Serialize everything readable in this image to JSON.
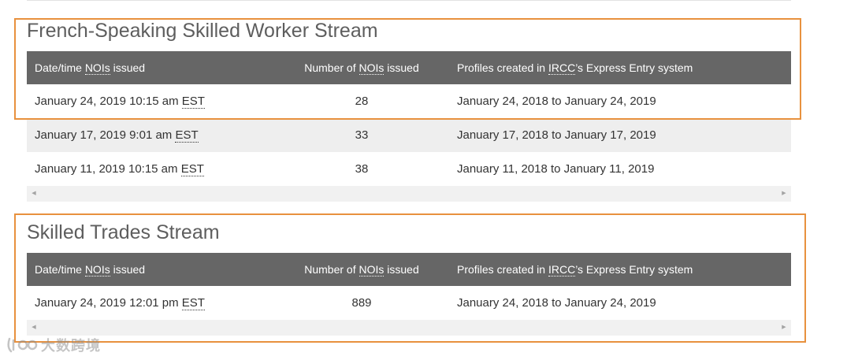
{
  "sections": [
    {
      "title": "French-Speaking Skilled Worker Stream",
      "headers": {
        "col1_pre": "Date/time ",
        "col1_abbr": "NOIs",
        "col1_post": " issued",
        "col2_pre": "Number of ",
        "col2_abbr": "NOIs",
        "col2_post": " issued",
        "col3_pre": "Profiles created in ",
        "col3_abbr": "IRCC",
        "col3_post": "’s Express Entry system"
      },
      "rows": [
        {
          "date": "January 24, 2019 10:15 am ",
          "tz": "EST",
          "count": "28",
          "range": "January 24, 2018 to January 24, 2019"
        },
        {
          "date": "January 17, 2019 9:01 am ",
          "tz": "EST",
          "count": "33",
          "range": "January 17, 2018 to January 17, 2019"
        },
        {
          "date": "January 11, 2019 10:15 am ",
          "tz": "EST",
          "count": "38",
          "range": "January 11, 2018 to January 11, 2019"
        }
      ],
      "scroll_left": "◀",
      "scroll_right": "▶"
    },
    {
      "title": "Skilled Trades Stream",
      "headers": {
        "col1_pre": "Date/time ",
        "col1_abbr": "NOIs",
        "col1_post": " issued",
        "col2_pre": "Number of ",
        "col2_abbr": "NOIs",
        "col2_post": " issued",
        "col3_pre": "Profiles created in ",
        "col3_abbr": "IRCC",
        "col3_post": "’s Express Entry system"
      },
      "rows": [
        {
          "date": "January 24, 2019 12:01 pm ",
          "tz": "EST",
          "count": "889",
          "range": "January 24, 2018 to January 24, 2019"
        }
      ],
      "scroll_left": "◀",
      "scroll_right": "▶"
    }
  ],
  "watermark": {
    "text": "大数跨境"
  },
  "colors": {
    "header_bg": "#666666",
    "stripe_bg": "#eeeeee",
    "highlight": "#e8913e",
    "title": "#5e5e5e"
  }
}
